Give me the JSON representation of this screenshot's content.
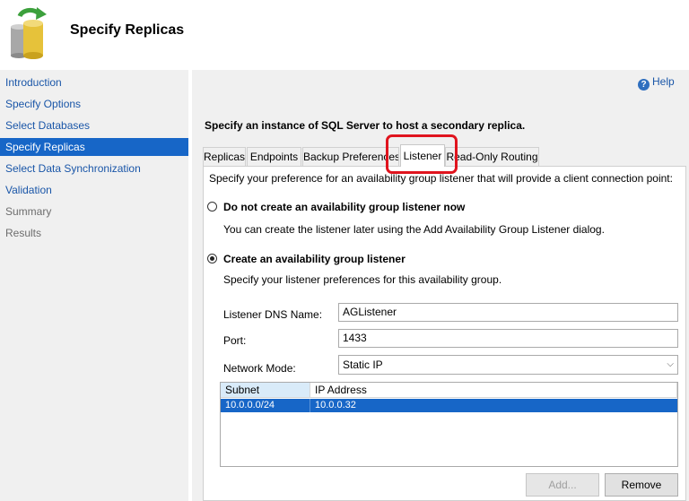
{
  "header": {
    "title": "Specify Replicas",
    "icon": "database-icon"
  },
  "sidebar": {
    "items": [
      {
        "label": "Introduction",
        "state": "link"
      },
      {
        "label": "Specify Options",
        "state": "link"
      },
      {
        "label": "Select Databases",
        "state": "link"
      },
      {
        "label": "Specify Replicas",
        "state": "active"
      },
      {
        "label": "Select Data Synchronization",
        "state": "link"
      },
      {
        "label": "Validation",
        "state": "link"
      },
      {
        "label": "Summary",
        "state": "disabled"
      },
      {
        "label": "Results",
        "state": "disabled"
      }
    ]
  },
  "help": {
    "label": "Help",
    "icon": "help-icon"
  },
  "main": {
    "instruction": "Specify an instance of SQL Server to host a secondary replica.",
    "tabs": [
      {
        "label": "Replicas"
      },
      {
        "label": "Endpoints"
      },
      {
        "label": "Backup Preferences"
      },
      {
        "label": "Listener",
        "selected": true
      },
      {
        "label": "Read-Only Routing"
      }
    ],
    "listener": {
      "intro": "Specify your preference for an availability group listener that will provide a client connection point:",
      "option_none": {
        "label": "Do not create an availability group listener now",
        "description": "You can create the listener later using the Add Availability Group Listener dialog."
      },
      "option_create": {
        "label": "Create an availability group listener",
        "description": "Specify your listener preferences for this availability group."
      },
      "dns_label": "Listener DNS Name:",
      "dns_value": "AGListener",
      "port_label": "Port:",
      "port_value": "1433",
      "mode_label": "Network Mode:",
      "mode_value": "Static IP",
      "grid": {
        "columns": [
          "Subnet",
          "IP Address"
        ],
        "rows": [
          {
            "subnet": "10.0.0.0/24",
            "ip": "10.0.0.32"
          }
        ]
      },
      "add_label": "Add...",
      "remove_label": "Remove"
    }
  },
  "colors": {
    "accent": "#1766c7",
    "highlight": "#e0141e",
    "link": "#1a56a8"
  }
}
